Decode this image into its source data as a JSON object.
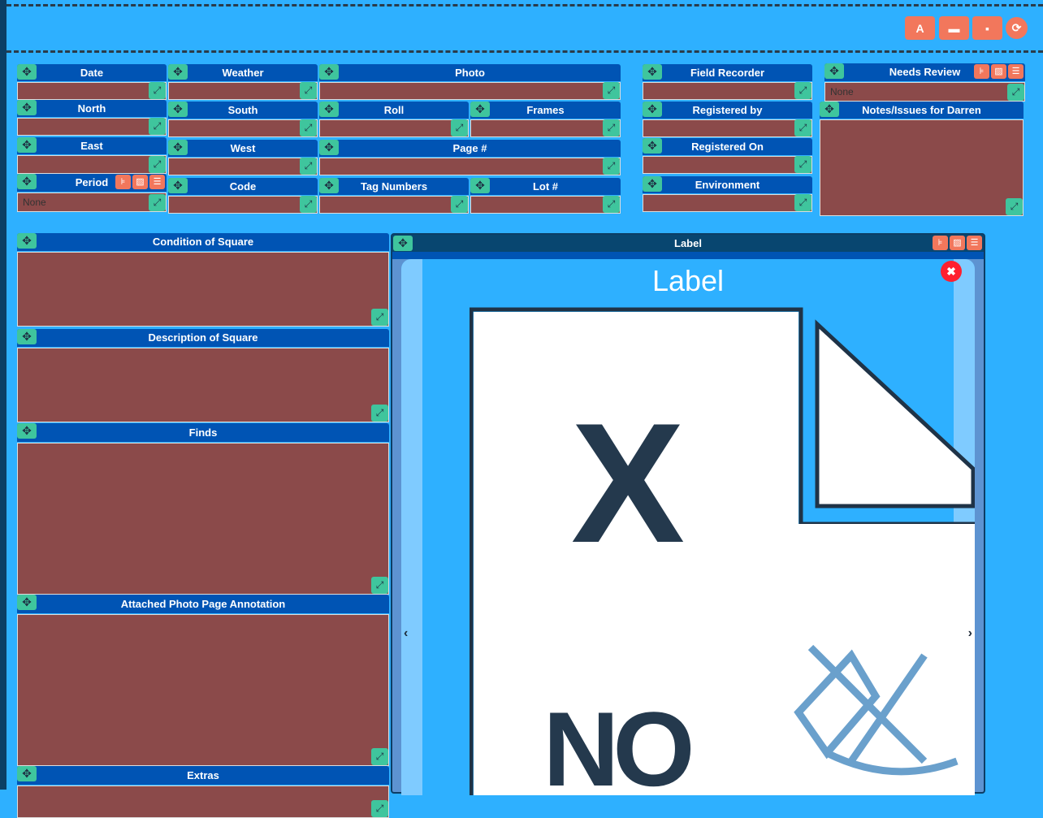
{
  "toolbar": {
    "buttons": [
      {
        "name": "pdf-button",
        "icon": "A"
      },
      {
        "name": "open-button",
        "icon": "▬"
      },
      {
        "name": "save-button",
        "icon": "▪"
      },
      {
        "name": "refresh-button",
        "icon": "⟳"
      }
    ]
  },
  "fields": [
    {
      "label": "Date"
    },
    {
      "label": "North"
    },
    {
      "label": "East"
    },
    {
      "label": "Period",
      "value": "None"
    },
    {
      "label": "Weather"
    },
    {
      "label": "South"
    },
    {
      "label": "West"
    },
    {
      "label": "Code"
    },
    {
      "label": "Photo"
    },
    {
      "label": "Roll"
    },
    {
      "label": "Frames"
    },
    {
      "label": "Page #"
    },
    {
      "label": "Tag Numbers"
    },
    {
      "label": "Lot #"
    },
    {
      "label": "Field Recorder"
    },
    {
      "label": "Registered by"
    },
    {
      "label": "Registered On"
    },
    {
      "label": "Environment"
    },
    {
      "label": "Needs Review",
      "value": "None"
    },
    {
      "label": "Notes/Issues for Darren"
    },
    {
      "label": "Condition of Square"
    },
    {
      "label": "Description of Square"
    },
    {
      "label": "Finds"
    },
    {
      "label": "Attached Photo Page Annotation"
    },
    {
      "label": "Extras"
    }
  ],
  "label_panel": {
    "title": "Label",
    "carousel_title": "Label",
    "image_text": {
      "x": "X",
      "no": "NO"
    }
  },
  "colors": {
    "background": "#2eb0ff",
    "header": "#0054b4",
    "input": "#8b4a4a",
    "handle": "#3fc59d",
    "action": "#f2775c"
  }
}
